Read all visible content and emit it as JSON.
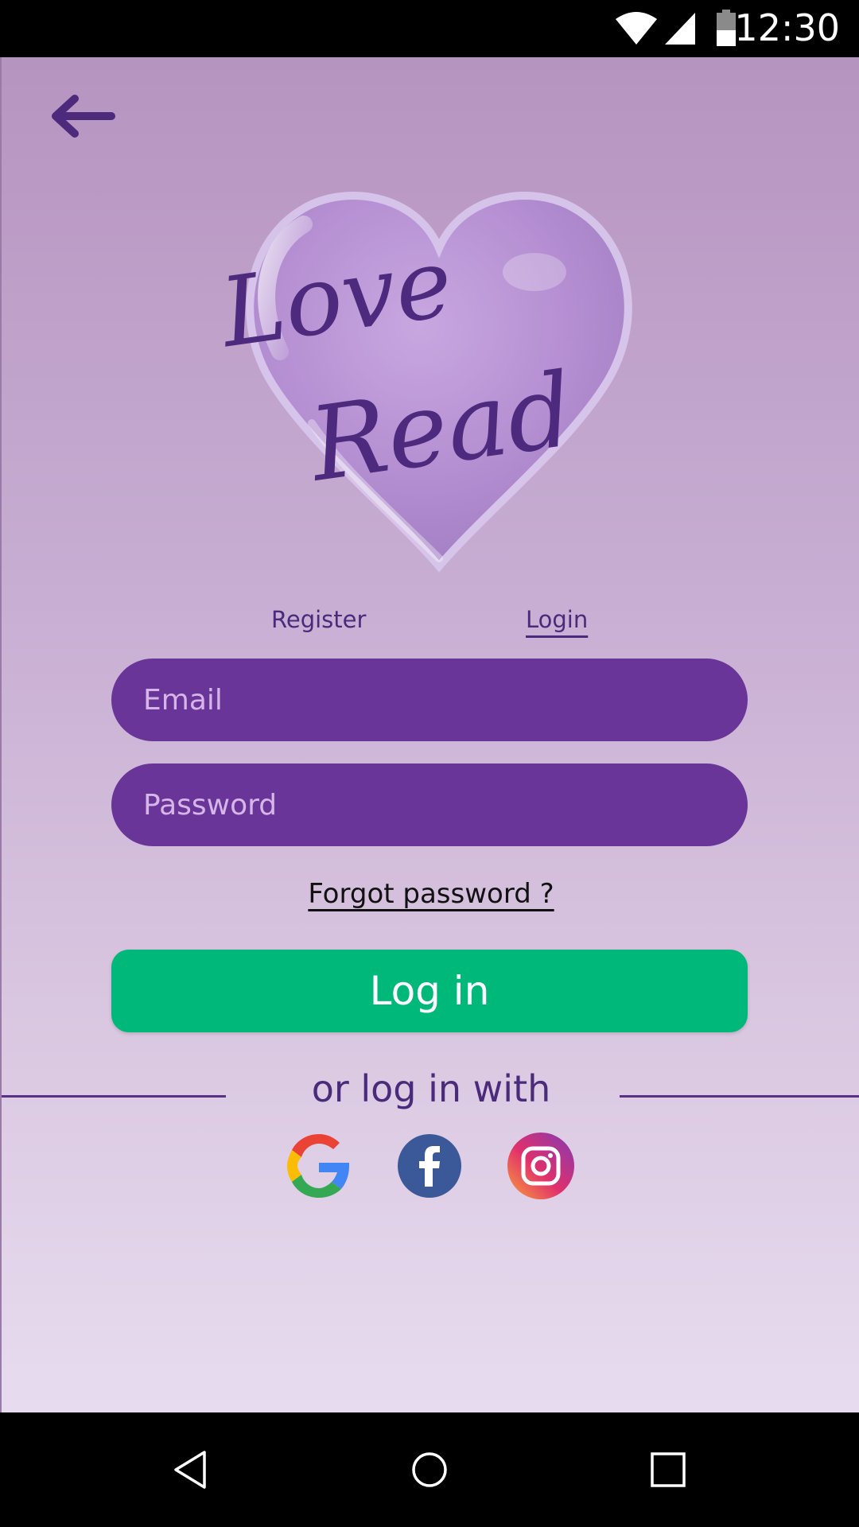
{
  "status_bar": {
    "time": "12:30"
  },
  "logo": {
    "text": "Love Read"
  },
  "tabs": {
    "register": "Register",
    "login": "Login",
    "active": "Login"
  },
  "form": {
    "email_placeholder": "Email",
    "password_placeholder": "Password",
    "forgot_label": "Forgot password ?",
    "login_label": "Log in"
  },
  "social": {
    "divider_text": "or log in with"
  },
  "colors": {
    "accent": "#6a3598",
    "button": "#00b87a",
    "text": "#4a2a7a"
  },
  "icons": [
    "back-arrow-icon",
    "google-icon",
    "facebook-icon",
    "instagram-icon",
    "wifi-icon",
    "signal-icon",
    "battery-icon"
  ]
}
